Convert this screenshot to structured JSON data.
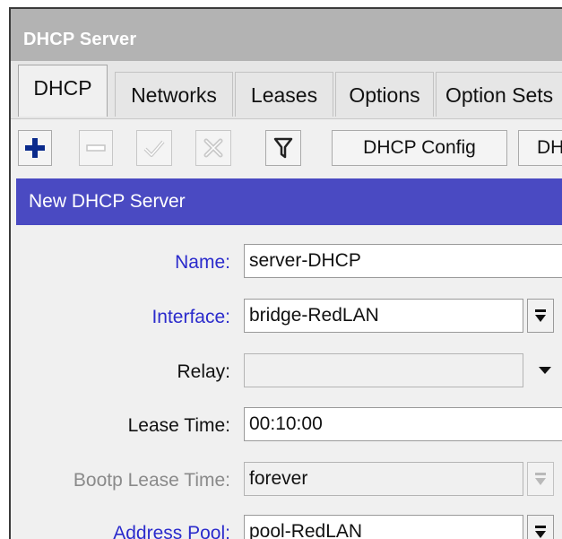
{
  "window": {
    "title": "DHCP Server"
  },
  "tabs": [
    {
      "label": "DHCP",
      "active": true
    },
    {
      "label": "Networks",
      "active": false
    },
    {
      "label": "Leases",
      "active": false
    },
    {
      "label": "Options",
      "active": false
    },
    {
      "label": "Option Sets",
      "active": false
    }
  ],
  "toolbar": {
    "add_icon": "plus-icon",
    "remove_icon": "minus-icon",
    "enable_icon": "check-icon",
    "disable_icon": "cross-icon",
    "filter_icon": "funnel-icon",
    "dhcp_config_label": "DHCP Config",
    "dhcp_setup_label": "DH"
  },
  "dialog": {
    "title": "New DHCP Server",
    "fields": {
      "name": {
        "label": "Name:",
        "value": "server-DHCP"
      },
      "interface": {
        "label": "Interface:",
        "value": "bridge-RedLAN"
      },
      "relay": {
        "label": "Relay:",
        "value": ""
      },
      "lease_time": {
        "label": "Lease Time:",
        "value": "00:10:00"
      },
      "bootp_lease_time": {
        "label": "Bootp Lease Time:",
        "value": "forever"
      },
      "address_pool": {
        "label": "Address Pool:",
        "value": "pool-RedLAN"
      }
    }
  },
  "colors": {
    "title_bar": "#b3b3b3",
    "dialog_title": "#4a4ac2",
    "label_blue": "#2b2bcc",
    "add_icon": "#0a2a8c"
  }
}
